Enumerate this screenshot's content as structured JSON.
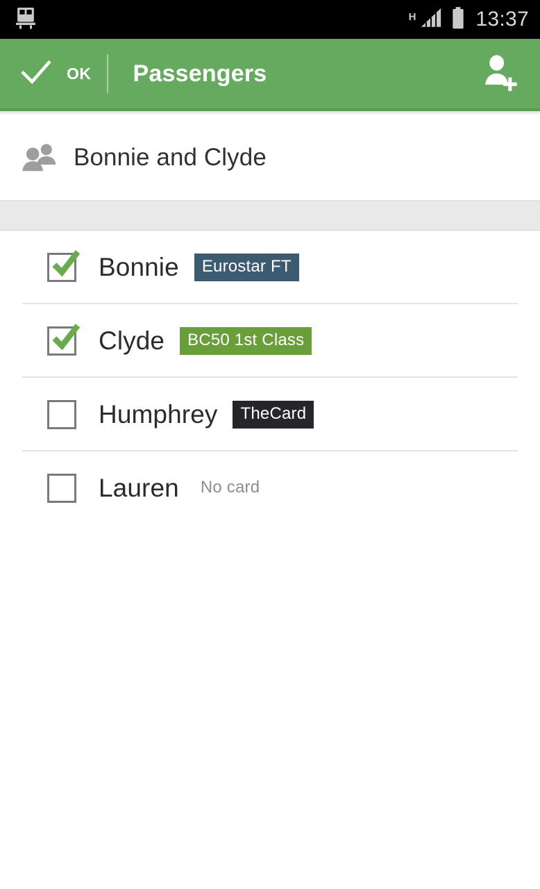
{
  "status_bar": {
    "notification_icon": "train-icon",
    "network_type": "H",
    "signal_icon": "signal-bars-icon",
    "battery_icon": "battery-icon",
    "time": "13:37"
  },
  "action_bar": {
    "up_icon": "checkmark-icon",
    "ok_label": "OK",
    "title": "Passengers",
    "action_icon": "add-person-icon",
    "background_color": "#66aa5f",
    "text_color": "#ffffff"
  },
  "group_header": {
    "icon": "group-people-icon",
    "name": "Bonnie and Clyde"
  },
  "passengers": [
    {
      "name": "Bonnie",
      "checked": true,
      "card_label": "Eurostar FT",
      "card_color": "#3c5a70",
      "has_card": true
    },
    {
      "name": "Clyde",
      "checked": true,
      "card_label": "BC50 1st Class",
      "card_color": "#6a9e3b",
      "has_card": true
    },
    {
      "name": "Humphrey",
      "checked": false,
      "card_label": "TheCard",
      "card_color": "#26262a",
      "has_card": true
    },
    {
      "name": "Lauren",
      "checked": false,
      "card_label": "No card",
      "card_color": "transparent",
      "has_card": false
    }
  ],
  "colors": {
    "accent_green": "#66aa5f",
    "checkbox_green": "#6aab4f",
    "divider": "#e4e4e4",
    "section_band": "#e9e9e9",
    "primary_text": "#2b2b2b",
    "muted_text": "#8d8d8d"
  }
}
